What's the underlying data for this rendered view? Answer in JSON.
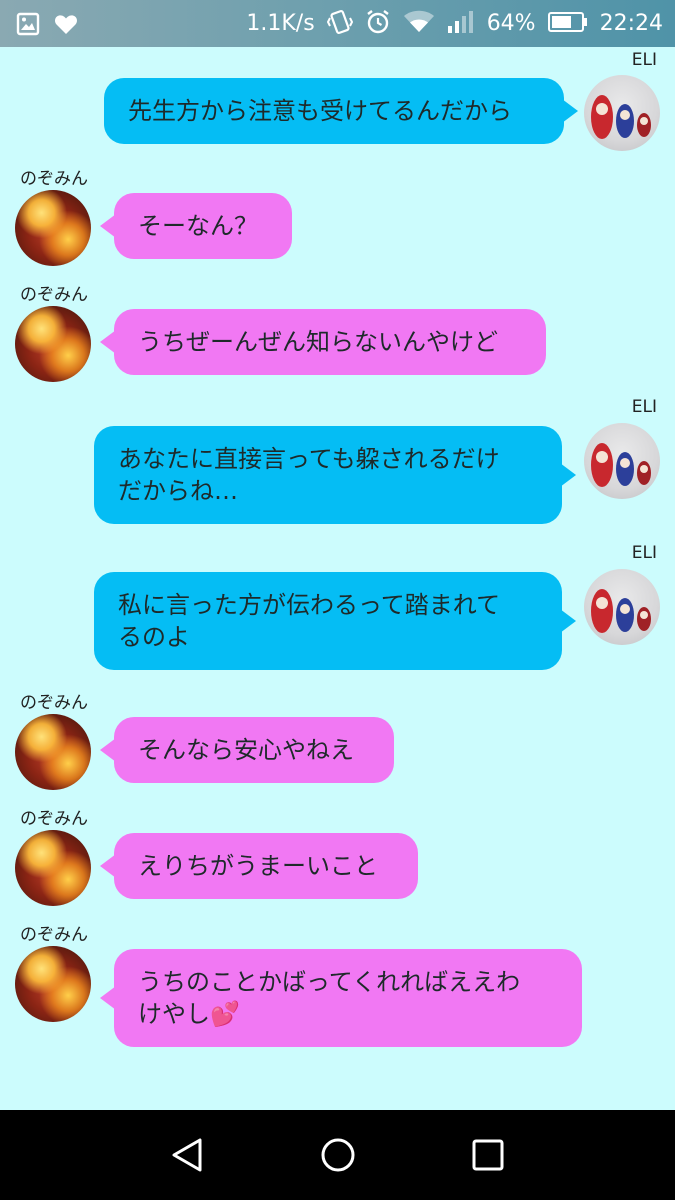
{
  "status_bar": {
    "net_speed": "1.1K/s",
    "battery": "64%",
    "time": "22:24",
    "icons": [
      "gallery-icon",
      "heart-icon",
      "vibrate-icon",
      "alarm-icon",
      "wifi-icon",
      "signal-icon",
      "battery-icon"
    ]
  },
  "messages": [
    {
      "side": "out",
      "sender": "ELI",
      "text": "先生方から注意も受けてるんだから"
    },
    {
      "side": "in",
      "sender": "のぞみん",
      "text": "そーなん？"
    },
    {
      "side": "in",
      "sender": "のぞみん",
      "text": "うちぜーんぜん知らないんやけど"
    },
    {
      "side": "out",
      "sender": "ELI",
      "text": "あなたに直接言っても躱されるだけ\nだからね…"
    },
    {
      "side": "out",
      "sender": "ELI",
      "text": "私に言った方が伝わるって踏まれて\nるのよ"
    },
    {
      "side": "in",
      "sender": "のぞみん",
      "text": "そんなら安心やねえ"
    },
    {
      "side": "in",
      "sender": "のぞみん",
      "text": "えりちがうまーいこと"
    },
    {
      "side": "in",
      "sender": "のぞみん",
      "text": "うちのことかばってくれればええわ\nけやし💕"
    }
  ],
  "nav_bar": {
    "buttons": [
      "back-icon",
      "home-icon",
      "recents-icon"
    ]
  },
  "colors": {
    "background": "#ccfcfd",
    "outgoing_bubble": "#05bdf4",
    "incoming_bubble": "#f178f3",
    "status_bar": "#6fa0ae",
    "nav_bar": "#000000"
  }
}
